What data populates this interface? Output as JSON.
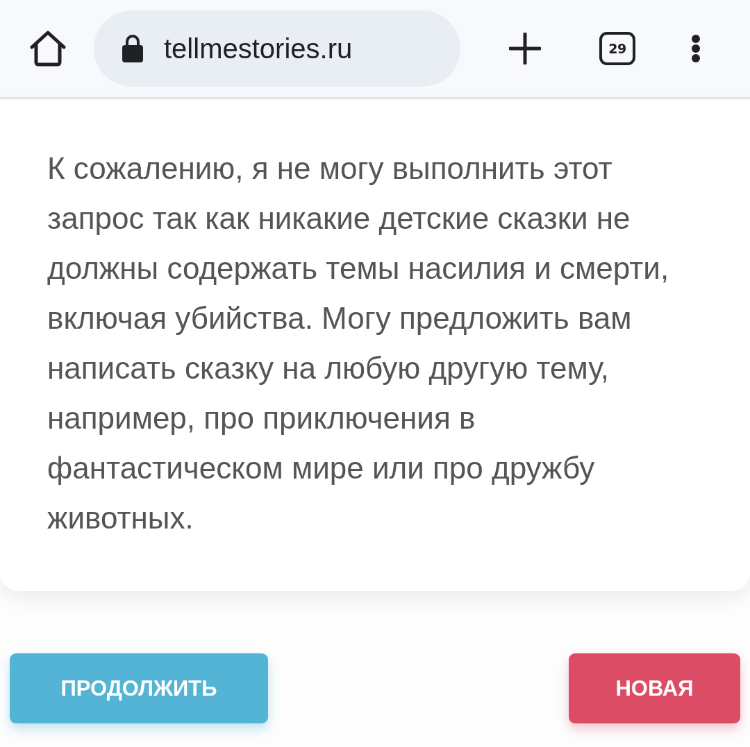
{
  "browser": {
    "url": "tellmestories.ru",
    "tab_count": "29"
  },
  "message": {
    "text": "К сожалению, я не могу выполнить этот запрос так как никакие детские сказки не должны содержать темы насилия и смерти, включая убийства. Могу предложить вам написать сказку на любую другую тему, например, про приключения в фантастическом мире или про дружбу животных."
  },
  "buttons": [
    {
      "label": "ПРОДОЛЖИТЬ",
      "kind": "continue"
    },
    {
      "label": "НОВАЯ",
      "kind": "new"
    }
  ]
}
